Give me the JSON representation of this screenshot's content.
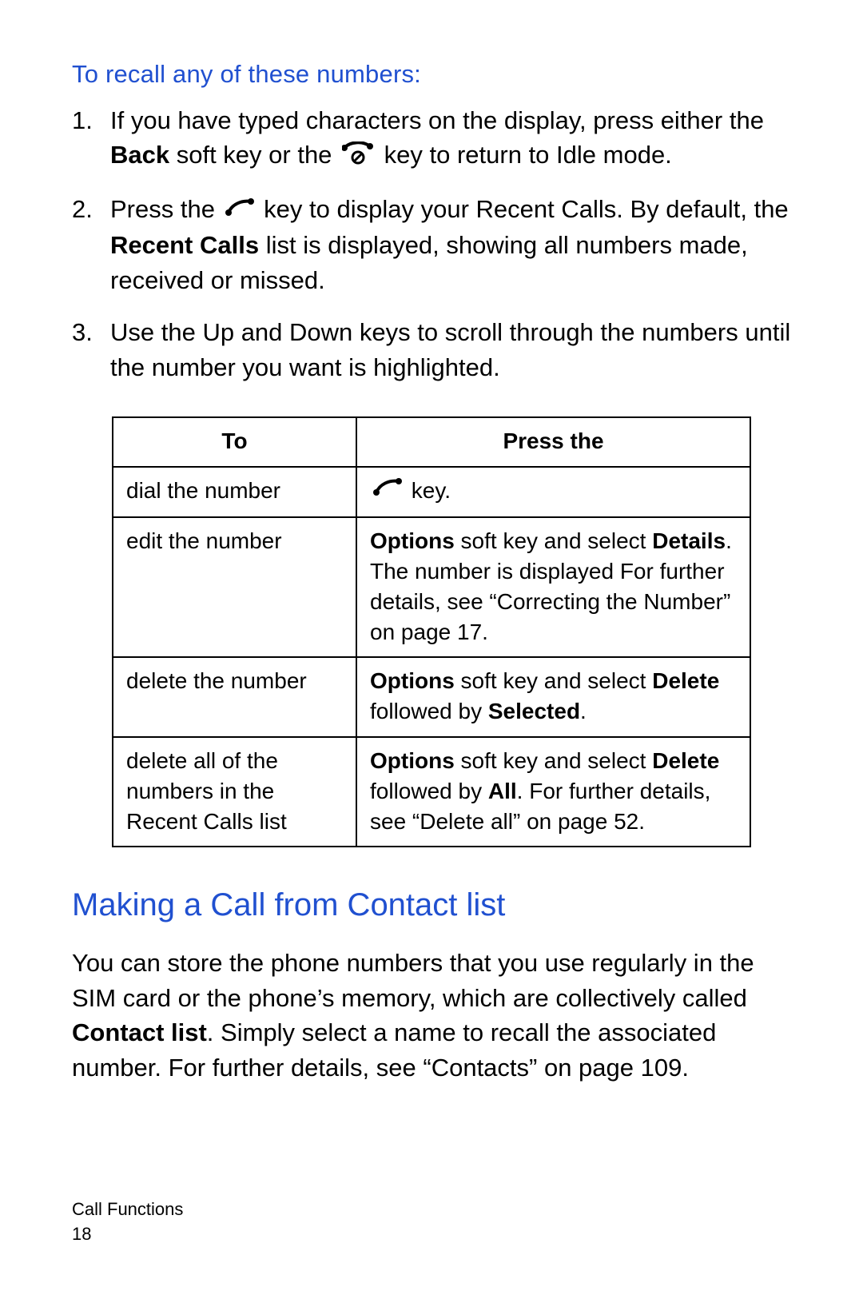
{
  "subhead": "To recall any of these numbers:",
  "steps": [
    {
      "num": "1.",
      "parts": [
        {
          "t": "If you have typed characters on the display, press either the "
        },
        {
          "t": "Back",
          "b": true
        },
        {
          "t": " soft key or the "
        },
        {
          "icon": "end-call-icon"
        },
        {
          "t": " key to return to Idle mode."
        }
      ]
    },
    {
      "num": "2.",
      "parts": [
        {
          "t": "Press the "
        },
        {
          "icon": "call-icon"
        },
        {
          "t": " key to display your Recent Calls. By default, the "
        },
        {
          "t": "Recent Calls",
          "b": true
        },
        {
          "t": " list is displayed, showing all numbers made, received or missed."
        }
      ]
    },
    {
      "num": "3.",
      "parts": [
        {
          "t": "Use the Up and Down keys to scroll through the numbers until the number you want is highlighted."
        }
      ]
    }
  ],
  "table": {
    "head": {
      "to": "To",
      "press": "Press the"
    },
    "rows": [
      {
        "to": "dial the number",
        "press_parts": [
          {
            "icon": "call-icon"
          },
          {
            "t": " key."
          }
        ]
      },
      {
        "to": "edit the number",
        "press_parts": [
          {
            "t": "Options",
            "b": true
          },
          {
            "t": " soft key and select "
          },
          {
            "t": "Details",
            "b": true
          },
          {
            "t": ". The number is displayed For further details, see “Correcting the Number” on page 17."
          }
        ]
      },
      {
        "to": "delete the number",
        "press_parts": [
          {
            "t": "Options",
            "b": true
          },
          {
            "t": " soft key and select "
          },
          {
            "t": "Delete",
            "b": true
          },
          {
            "t": " followed by "
          },
          {
            "t": "Selected",
            "b": true
          },
          {
            "t": "."
          }
        ]
      },
      {
        "to": "delete all of the numbers in the Recent Calls list",
        "press_parts": [
          {
            "t": "Options",
            "b": true
          },
          {
            "t": " soft key and select "
          },
          {
            "t": "Delete",
            "b": true
          },
          {
            "t": " followed by "
          },
          {
            "t": "All",
            "b": true
          },
          {
            "t": ". For further details, see “Delete all” on page 52."
          }
        ]
      }
    ]
  },
  "section_head": "Making a Call from Contact list",
  "para_parts": [
    {
      "t": "You can store the phone numbers that you use regularly in the SIM card or the phone’s memory, which are collectively called "
    },
    {
      "t": "Contact list",
      "b": true
    },
    {
      "t": ". Simply select a name to recall the associated number. For further details, see “Contacts” on page 109."
    }
  ],
  "footer": {
    "section": "Call Functions",
    "page": "18"
  },
  "icons": {
    "call-icon": "call",
    "end-call-icon": "end"
  }
}
